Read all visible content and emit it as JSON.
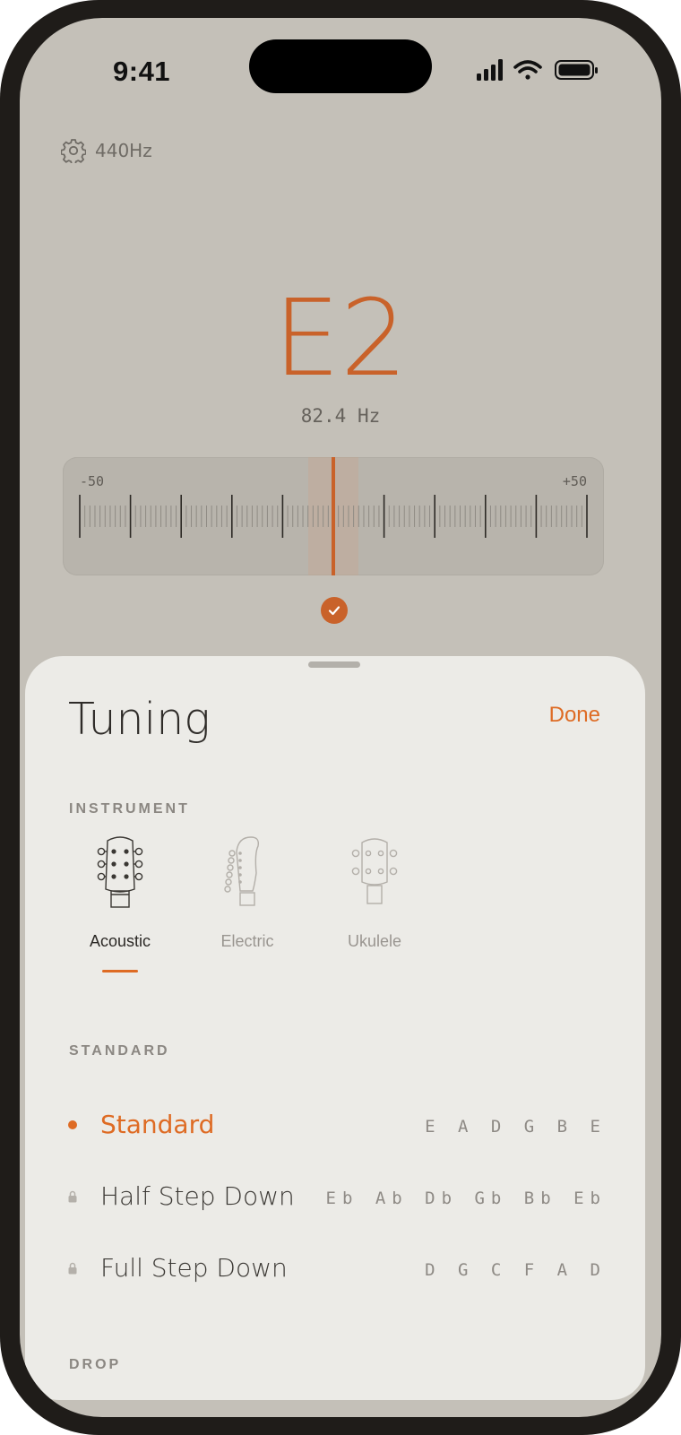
{
  "status_bar": {
    "time": "9:41"
  },
  "settings": {
    "reference": "440Hz"
  },
  "tuner": {
    "note": "E2",
    "frequency": "82.4 Hz",
    "scale_min_label": "-50",
    "scale_max_label": "+50",
    "cents_offset": 0,
    "in_tune": true
  },
  "sheet": {
    "title": "Tuning",
    "done_label": "Done",
    "instrument_section": "INSTRUMENT",
    "instruments": [
      {
        "label": "Acoustic",
        "icon": "acoustic-headstock-icon",
        "selected": true
      },
      {
        "label": "Electric",
        "icon": "electric-headstock-icon",
        "selected": false
      },
      {
        "label": "Ukulele",
        "icon": "ukulele-headstock-icon",
        "selected": false
      }
    ],
    "standard_section": "STANDARD",
    "tunings": [
      {
        "name": "Standard",
        "notes": "E A D G B E",
        "selected": true,
        "locked": false
      },
      {
        "name": "Half Step Down",
        "notes": "Eb Ab Db Gb Bb Eb",
        "selected": false,
        "locked": true
      },
      {
        "name": "Full Step Down",
        "notes": "D G C F A D",
        "selected": false,
        "locked": true
      }
    ],
    "drop_section": "DROP"
  },
  "colors": {
    "accent": "#de6b24",
    "note": "#c9622a",
    "background": "#c4c0b8",
    "sheet": "#ecebe7"
  }
}
